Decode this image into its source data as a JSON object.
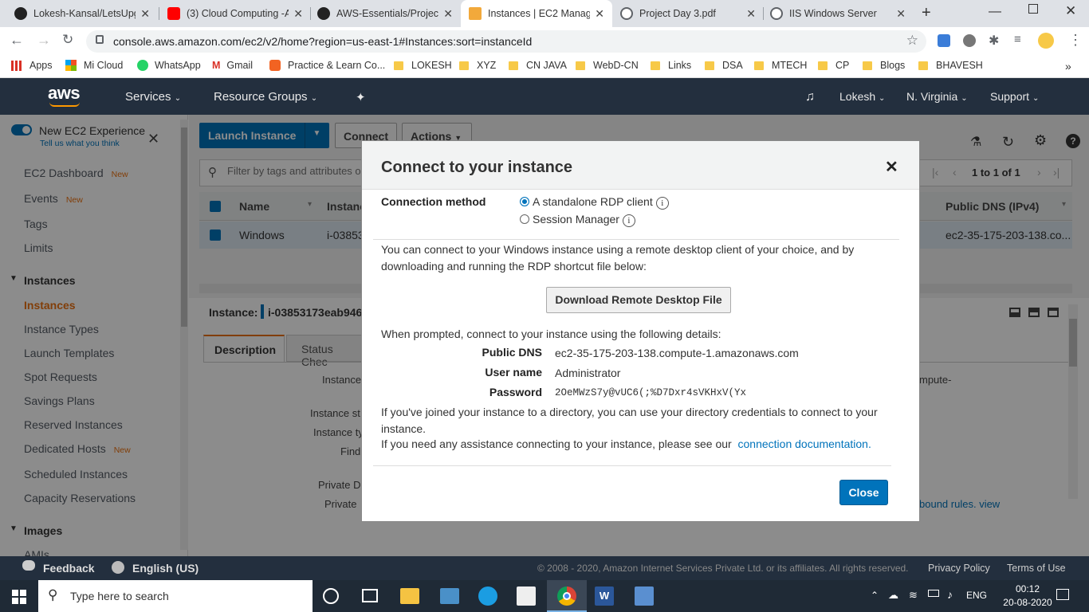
{
  "browser": {
    "tabs": [
      {
        "title": "Lokesh-Kansal/LetsUpg",
        "icon": "github-icon"
      },
      {
        "title": "(3) Cloud Computing -A",
        "icon": "youtube-icon"
      },
      {
        "title": "AWS-Essentials/Project",
        "icon": "github-icon"
      },
      {
        "title": "Instances | EC2 Manage",
        "icon": "aws-box-icon"
      },
      {
        "title": "Project Day 3.pdf",
        "icon": "globe-icon"
      },
      {
        "title": "IIS Windows Server",
        "icon": "globe-icon"
      }
    ],
    "url": "console.aws.amazon.com/ec2/v2/home?region=us-east-1#Instances:sort=instanceId",
    "bookmarks": [
      "Apps",
      "Mi Cloud",
      "WhatsApp",
      "Gmail",
      "Practice & Learn Co...",
      "LOKESH",
      "XYZ",
      "CN JAVA",
      "WebD-CN",
      "Links",
      "DSA",
      "MTECH",
      "CP",
      "Blogs",
      "BHAVESH"
    ]
  },
  "aws_nav": {
    "logo": "aws",
    "services": "Services",
    "resource_groups": "Resource Groups",
    "user": "Lokesh",
    "region": "N. Virginia",
    "support": "Support"
  },
  "sidebar": {
    "new_experience": "New EC2 Experience",
    "tell_us": "Tell us what you think",
    "items": [
      {
        "label": "EC2 Dashboard",
        "badge": "New"
      },
      {
        "label": "Events",
        "badge": "New"
      },
      {
        "label": "Tags",
        "badge": ""
      },
      {
        "label": "Limits",
        "badge": ""
      }
    ],
    "instances_header": "Instances",
    "instance_items": [
      {
        "label": "Instances",
        "badge": ""
      },
      {
        "label": "Instance Types",
        "badge": ""
      },
      {
        "label": "Launch Templates",
        "badge": ""
      },
      {
        "label": "Spot Requests",
        "badge": ""
      },
      {
        "label": "Savings Plans",
        "badge": ""
      },
      {
        "label": "Reserved Instances",
        "badge": ""
      },
      {
        "label": "Dedicated Hosts",
        "badge": "New"
      },
      {
        "label": "Scheduled Instances",
        "badge": ""
      },
      {
        "label": "Capacity Reservations",
        "badge": ""
      }
    ],
    "images_header": "Images",
    "images_partial": "AMIs"
  },
  "main": {
    "launch": "Launch Instance",
    "connect": "Connect",
    "actions": "Actions",
    "filter_placeholder": "Filter by tags and attributes or se",
    "pager": "1 to 1 of 1",
    "col_name": "Name",
    "col_instance": "Instance",
    "col_dns": "Public DNS (IPv4)",
    "row_name": "Windows",
    "row_instance": "i-03853",
    "row_dns": "ec2-35-175-203-138.co...",
    "detail_label": "Instance:",
    "detail_id": "i-03853173eab946",
    "tab_description": "Description",
    "tab_status": "Status Chec",
    "field_labels": [
      "Instance",
      "Instance st",
      "Instance ty",
      "Find",
      "Private D",
      "Private"
    ],
    "right_partial_1": "mpute-",
    "right_partial_2": "bound rules.",
    "right_partial_link": "view"
  },
  "modal": {
    "title": "Connect to your instance",
    "connection_method_label": "Connection method",
    "option_rdp": "A standalone RDP client",
    "option_ssm": "Session Manager",
    "intro": "You can connect to your Windows instance using a remote desktop client of your choice, and by downloading and running the RDP shortcut file below:",
    "download_button": "Download Remote Desktop File",
    "prompt_text": "When prompted, connect to your instance using the following details:",
    "dns_label": "Public DNS",
    "dns_value": "ec2-35-175-203-138.compute-1.amazonaws.com",
    "user_label": "User name",
    "user_value": "Administrator",
    "password_label": "Password",
    "password_value": "2OeMWzS7y@vUC6(;%D7Dxr4sVKHxV(Yx",
    "joined_text": "If you've joined your instance to a directory, you can use your directory credentials to connect to your instance.",
    "help_text": "If you need any assistance connecting to your instance, please see our",
    "help_link": "connection documentation",
    "close_button": "Close"
  },
  "footer": {
    "feedback": "Feedback",
    "language": "English (US)",
    "copyright": "© 2008 - 2020, Amazon Internet Services Private Ltd. or its affiliates. All rights reserved.",
    "privacy": "Privacy Policy",
    "terms": "Terms of Use"
  },
  "taskbar": {
    "search_placeholder": "Type here to search",
    "lang": "ENG",
    "time": "00:12",
    "date": "20-08-2020"
  },
  "colors": {
    "aws_nav": "#232f3e",
    "primary_blue": "#0073bb",
    "aws_orange": "#ec7211"
  }
}
